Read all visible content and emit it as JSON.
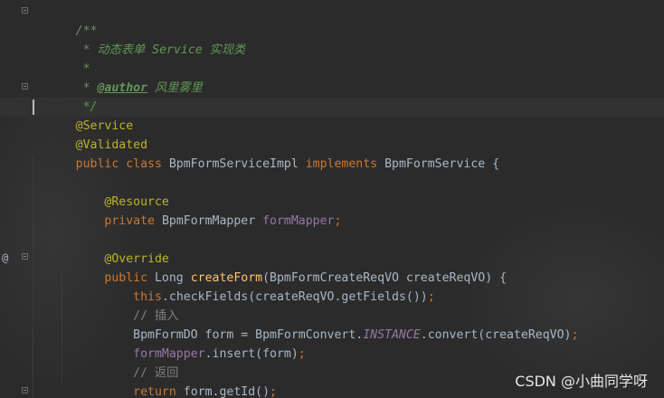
{
  "editor": {
    "lines": [
      [
        "/**"
      ],
      [
        " * 动态表单 Service 实现类"
      ],
      [
        " *"
      ],
      [
        " * ",
        "@author",
        " 风里雾里"
      ],
      [
        " */"
      ],
      [
        "@Service"
      ],
      [
        "@Validated"
      ],
      [
        "public class ",
        "BpmFormServiceImpl ",
        "implements ",
        "BpmFormService {"
      ],
      [
        ""
      ],
      [
        "    ",
        "@Resource"
      ],
      [
        "    ",
        "private ",
        "BpmFormMapper ",
        "formMapper",
        ";"
      ],
      [
        ""
      ],
      [
        "    ",
        "@Override"
      ],
      [
        "    ",
        "public ",
        "Long ",
        "createForm",
        "(BpmFormCreateReqVO createReqVO) {"
      ],
      [
        "        ",
        "this",
        ".checkFields(createReqVO.getFields())",
        ";"
      ],
      [
        "        // 插入"
      ],
      [
        "        BpmFormDO form = BpmFormConvert.",
        "INSTANCE",
        ".convert(createReqVO)",
        ";"
      ],
      [
        "        ",
        "formMapper",
        ".insert(form)",
        ";"
      ],
      [
        "        // 返回"
      ],
      [
        "        ",
        "return ",
        "form.getId()",
        ";"
      ],
      [
        "    }"
      ]
    ]
  },
  "gutter": {
    "override_marker": "@"
  },
  "watermark": {
    "text": "CSDN @小曲同学呀"
  },
  "colors": {
    "background": "#2b2b2b",
    "comment": "#629755",
    "annotation": "#bbb529",
    "keyword": "#cc7832",
    "field": "#9876aa",
    "method": "#ffc66d",
    "text": "#a9b7c6"
  }
}
